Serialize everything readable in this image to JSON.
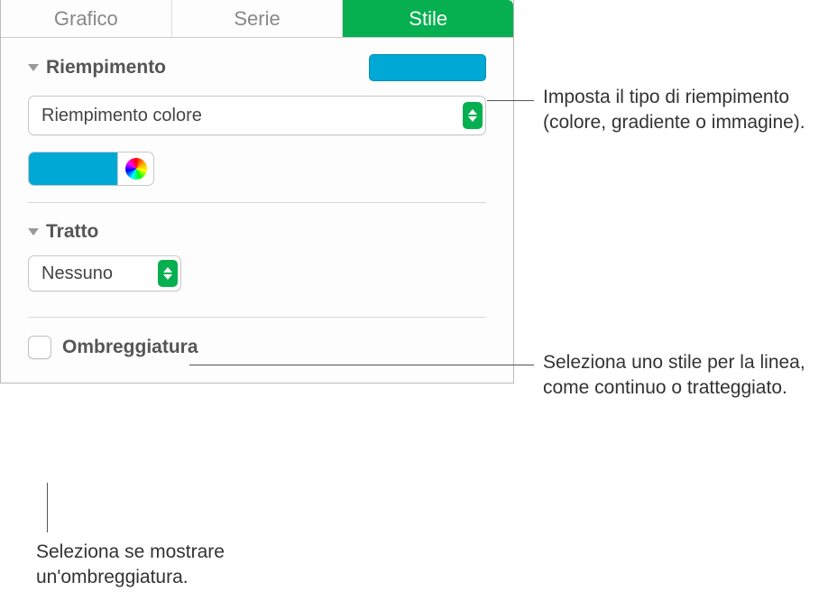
{
  "tabs": {
    "grafico": "Grafico",
    "serie": "Serie",
    "stile": "Stile"
  },
  "fill": {
    "title": "Riempimento",
    "dropdown": "Riempimento colore",
    "preview_color": "#00a8d6"
  },
  "stroke": {
    "title": "Tratto",
    "dropdown": "Nessuno"
  },
  "shadow": {
    "label": "Ombreggiatura"
  },
  "callouts": {
    "fill": "Imposta il tipo di riempimento (colore, gradiente o immagine).",
    "stroke": "Seleziona uno stile per la linea, come continuo o tratteggiato.",
    "shadow": "Seleziona se mostrare un'ombreggiatura."
  }
}
